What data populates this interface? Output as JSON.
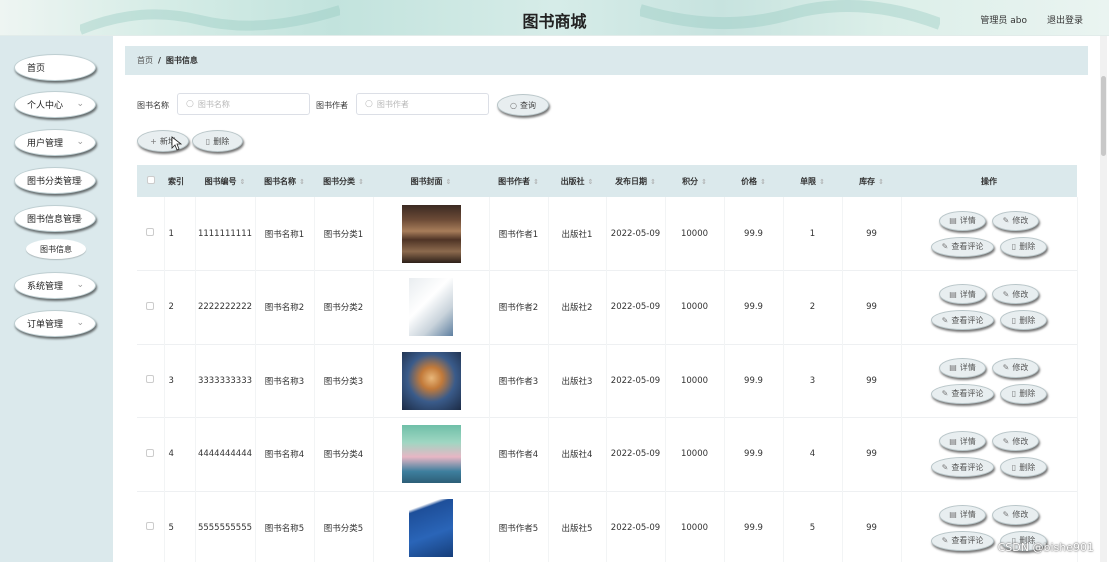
{
  "header": {
    "title": "图书商城",
    "admin_label": "管理员 abo",
    "logout_label": "退出登录"
  },
  "sidebar": {
    "items": [
      {
        "label": "首页",
        "has_chevron": false
      },
      {
        "label": "个人中心",
        "has_chevron": true
      },
      {
        "label": "用户管理",
        "has_chevron": true
      },
      {
        "label": "图书分类管理",
        "has_chevron": true
      },
      {
        "label": "图书信息管理",
        "has_chevron": true
      },
      {
        "label": "系统管理",
        "has_chevron": true
      },
      {
        "label": "订单管理",
        "has_chevron": true
      }
    ],
    "sub_item": "图书信息"
  },
  "breadcrumb": {
    "home": "首页",
    "separator": "/",
    "current": "图书信息"
  },
  "search": {
    "name_label": "图书名称",
    "name_placeholder": "图书名称",
    "author_label": "图书作者",
    "author_placeholder": "图书作者",
    "query_button": "查询"
  },
  "actions": {
    "add_button": "新增",
    "delete_button": "删除"
  },
  "table": {
    "columns": [
      "索引",
      "图书编号",
      "图书名称",
      "图书分类",
      "图书封面",
      "图书作者",
      "出版社",
      "发布日期",
      "积分",
      "价格",
      "单限",
      "库存",
      "操作"
    ],
    "row_buttons": {
      "detail": "详情",
      "edit": "修改",
      "comment": "查看评论",
      "delete": "删除"
    },
    "rows": [
      {
        "index": "1",
        "code": "1111111111",
        "name": "图书名称1",
        "category": "图书分类1",
        "author": "图书作者1",
        "publisher": "出版社1",
        "date": "2022-05-09",
        "points": "10000",
        "price": "99.9",
        "limit": "1",
        "stock": "99",
        "cover": "book-stack"
      },
      {
        "index": "2",
        "code": "2222222222",
        "name": "图书名称2",
        "category": "图书分类2",
        "author": "图书作者2",
        "publisher": "出版社2",
        "date": "2022-05-09",
        "points": "10000",
        "price": "99.9",
        "limit": "2",
        "stock": "99",
        "cover": "white-book"
      },
      {
        "index": "3",
        "code": "3333333333",
        "name": "图书名称3",
        "category": "图书分类3",
        "author": "图书作者3",
        "publisher": "出版社3",
        "date": "2022-05-09",
        "points": "10000",
        "price": "99.9",
        "limit": "3",
        "stock": "99",
        "cover": "illustrated-portrait"
      },
      {
        "index": "4",
        "code": "4444444444",
        "name": "图书名称4",
        "category": "图书分类4",
        "author": "图书作者4",
        "publisher": "出版社4",
        "date": "2022-05-09",
        "points": "10000",
        "price": "99.9",
        "limit": "4",
        "stock": "99",
        "cover": "children-book"
      },
      {
        "index": "5",
        "code": "5555555555",
        "name": "图书名称5",
        "category": "图书分类5",
        "author": "图书作者5",
        "publisher": "出版社5",
        "date": "2022-05-09",
        "points": "10000",
        "price": "99.9",
        "limit": "5",
        "stock": "99",
        "cover": "blue-book"
      }
    ]
  },
  "watermark": "CSDN @bishe901"
}
